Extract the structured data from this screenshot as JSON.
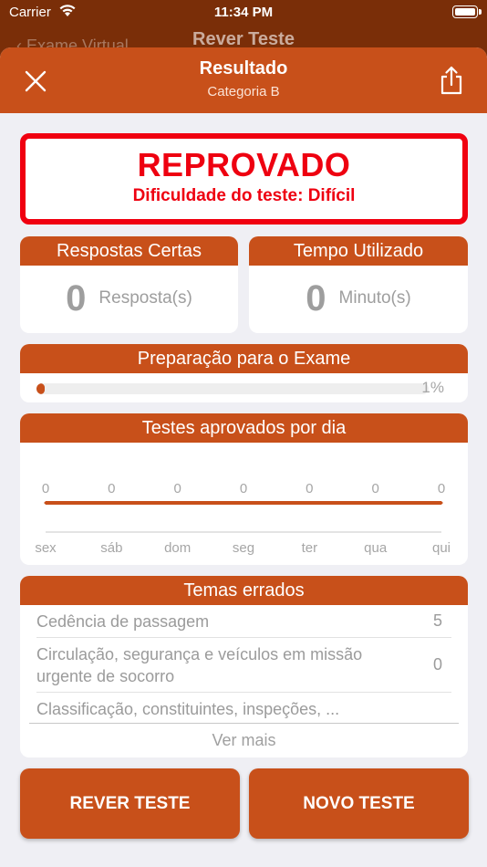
{
  "status_bar": {
    "carrier": "Carrier",
    "time": "11:34 PM"
  },
  "under_nav": {
    "title": "Rever Teste",
    "back_label": "Exame Virtual"
  },
  "header": {
    "title": "Resultado",
    "subtitle": "Categoria B"
  },
  "result": {
    "status": "REPROVADO",
    "difficulty": "Dificuldade do teste: Difícil"
  },
  "stats": {
    "correct": {
      "title": "Respostas Certas",
      "value": "0",
      "unit": "Resposta(s)"
    },
    "time": {
      "title": "Tempo Utilizado",
      "value": "0",
      "unit": "Minuto(s)"
    }
  },
  "preparation": {
    "title": "Preparação para o Exame",
    "percent_label": "1%",
    "fraction": 0.01
  },
  "daily_chart": {
    "title": "Testes aprovados por dia"
  },
  "chart_data": {
    "type": "line",
    "categories": [
      "sex",
      "sáb",
      "dom",
      "seg",
      "ter",
      "qua",
      "qui"
    ],
    "values": [
      0,
      0,
      0,
      0,
      0,
      0,
      0
    ],
    "data_labels": [
      "0",
      "0",
      "0",
      "0",
      "0",
      "0",
      "0"
    ],
    "color": "#c8501a"
  },
  "themes": {
    "title": "Temas errados",
    "items": [
      {
        "name": "Cedência de passagem",
        "count": "5"
      },
      {
        "name": "Circulação, segurança e veículos em missão urgente de socorro",
        "count": "0"
      },
      {
        "name": "Classificação, constituintes, inspeções, ...",
        "count": ""
      }
    ],
    "see_more": "Ver mais"
  },
  "buttons": {
    "review": "REVER TESTE",
    "new": "NOVO TESTE"
  },
  "colors": {
    "accent": "#c8501a",
    "fail": "#ee0010",
    "background": "#efeff4"
  }
}
